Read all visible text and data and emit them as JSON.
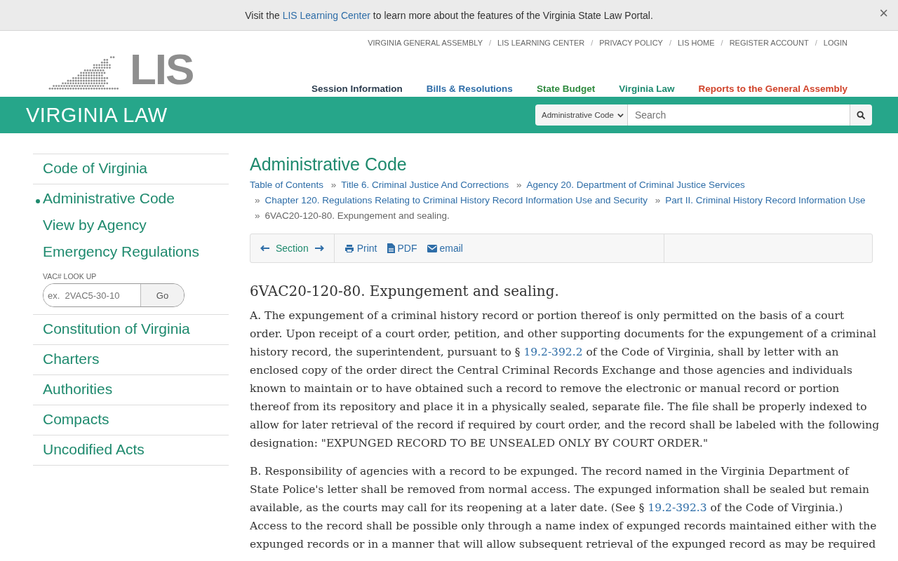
{
  "banner": {
    "before": "Visit the",
    "link": "LIS Learning Center",
    "after": "to learn more about the features of the Virginia State Law Portal.",
    "close": "×"
  },
  "header": {
    "logo": "LIS",
    "separator": "/",
    "top_links": [
      "VIRGINIA GENERAL ASSEMBLY",
      "LIS LEARNING CENTER",
      "PRIVACY POLICY",
      "LIS HOME",
      "REGISTER ACCOUNT",
      "LOGIN"
    ],
    "nav": [
      {
        "label": "Session Information",
        "color": "#2d3e50"
      },
      {
        "label": "Bills & Resolutions",
        "color": "#2f6ea8"
      },
      {
        "label": "State Budget",
        "color": "#2f8a3f"
      },
      {
        "label": "Virginia Law",
        "color": "#1d8a70"
      },
      {
        "label": "Reports to the General Assembly",
        "color": "#d0432a"
      }
    ]
  },
  "title_bar": {
    "title": "VIRGINIA LAW",
    "search": {
      "scope": "Administrative Code",
      "placeholder": "Search"
    }
  },
  "sidebar": {
    "items": [
      {
        "label": "Code of Virginia",
        "selected": false
      },
      {
        "label": "Administrative Code",
        "selected": true,
        "children": [
          "View by Agency",
          "Emergency Regulations"
        ],
        "lookup": {
          "label": "VAC# LOOK UP",
          "placeholder": "ex.  2VAC5-30-10",
          "button": "Go"
        }
      },
      {
        "label": "Constitution of Virginia",
        "selected": false
      },
      {
        "label": "Charters",
        "selected": false
      },
      {
        "label": "Authorities",
        "selected": false
      },
      {
        "label": "Compacts",
        "selected": false
      },
      {
        "label": "Uncodified Acts",
        "selected": false
      }
    ]
  },
  "content": {
    "title": "Administrative Code",
    "separator": "»",
    "breadcrumbs": [
      {
        "label": "Table of Contents",
        "link": true
      },
      {
        "label": "Title 6. Criminal Justice And Corrections",
        "link": true
      },
      {
        "label": "Agency 20. Department of Criminal Justice Services",
        "link": true
      },
      {
        "label": "Chapter 120. Regulations Relating to Criminal History Record Information Use and Security",
        "link": true
      },
      {
        "label": "Part II. Criminal History Record Information Use",
        "link": true
      },
      {
        "label": "6VAC20-120-80. Expungement and sealing.",
        "link": false
      }
    ],
    "toolbar": {
      "section": "Section",
      "actions": [
        {
          "kind": "print",
          "label": "Print"
        },
        {
          "kind": "pdf",
          "label": "PDF"
        },
        {
          "kind": "email",
          "label": "email"
        }
      ]
    },
    "heading": "6VAC20-120-80. Expungement and sealing.",
    "paragraphs": [
      {
        "before": "A. The expungement of a criminal history record or portion thereof is only permitted on the basis of a court order. Upon receipt of a court order, petition, and other supporting documents for the expungement of a criminal history record, the superintendent, pursuant to §",
        "link": "19.2-392.2",
        "after": "of the Code of Virginia, shall by letter with an enclosed copy of the order direct the Central Criminal Records Exchange and those agencies and individuals known to maintain or to have obtained such a record to remove the electronic or manual record or portion thereof from its repository and place it in a physically sealed, separate file. The file shall be properly indexed to allow for later retrieval of the record if required by court order, and the record shall be labeled with the following designation: \"EXPUNGED RECORD TO BE UNSEALED ONLY BY COURT ORDER.\""
      },
      {
        "before": "B. Responsibility of agencies with a record to be expunged. The record named in the Virginia Department of State Police's letter shall be removed from normal access. The expunged information shall be sealed but remain available, as the courts may call for its reopening at a later date. (See §",
        "link": "19.2-392.3",
        "after": "of the Code of Virginia.) Access to the record shall be possible only through a name index of expunged records maintained either with the expunged records or in a manner that will allow subsequent retrieval of the expunged record as may be required"
      }
    ]
  }
}
